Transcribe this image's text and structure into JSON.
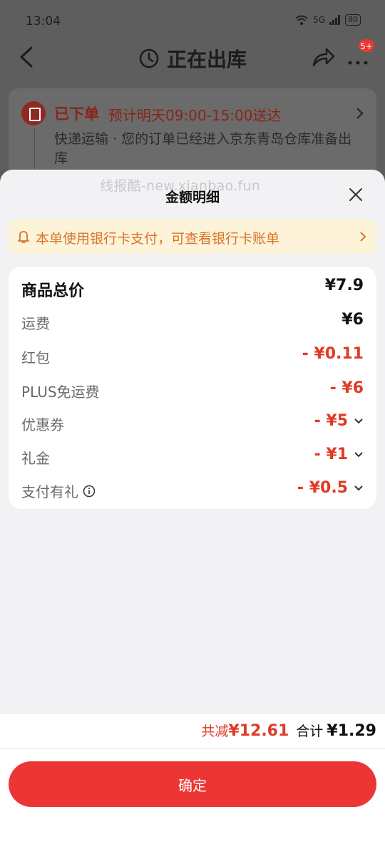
{
  "status_bar": {
    "time": "13:04",
    "network": "5G",
    "battery": "80"
  },
  "nav": {
    "title": "正在出库",
    "badge": "5+"
  },
  "order": {
    "status": "已下单",
    "eta": "预计明天09:00-15:00送达",
    "description": "快递运输 · 您的订单已经进入京东青岛仓库准备出库"
  },
  "sheet": {
    "watermark": "线报酷-new.xianbao.fun",
    "title": "金额明细",
    "notice": "本单使用银行卡支付，可查看银行卡账单",
    "rows": [
      {
        "label": "商品总价",
        "value": "¥7.9"
      },
      {
        "label": "运费",
        "value": "¥6"
      },
      {
        "label": "红包",
        "value": "- ¥0.11"
      },
      {
        "label": "PLUS免运费",
        "value": "- ¥6"
      },
      {
        "label": "优惠券",
        "value": "- ¥5"
      },
      {
        "label": "礼金",
        "value": "- ¥1"
      },
      {
        "label": "支付有礼",
        "value": "- ¥0.5"
      }
    ],
    "summary": {
      "reduced_label": "共减",
      "reduced_value": "¥12.61",
      "total_label": "合计",
      "total_value": "¥1.29"
    },
    "confirm_label": "确定"
  },
  "colors": {
    "accent_red": "#ec3636",
    "discount_red": "#e03a26",
    "notice_bg": "#fdf3d9",
    "notice_text": "#d8742a"
  }
}
